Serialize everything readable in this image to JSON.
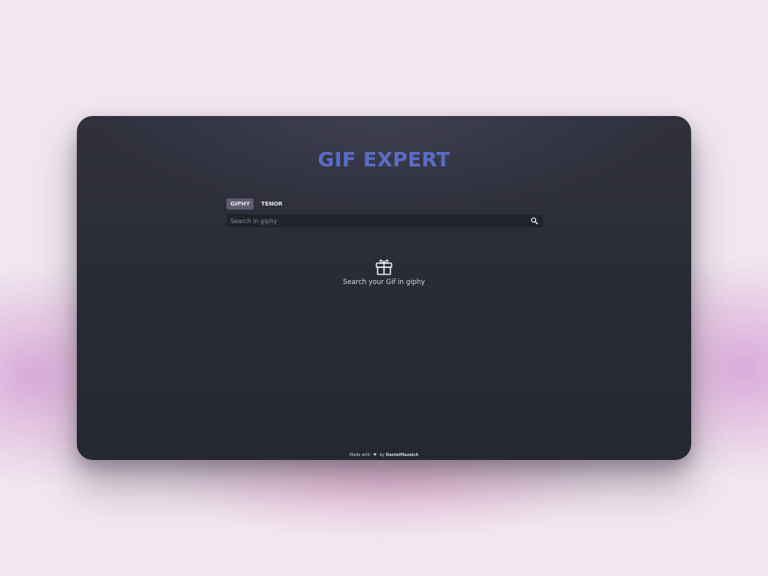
{
  "app": {
    "title": "GIF EXPERT"
  },
  "tabs": [
    {
      "label": "GIPHY",
      "active": true
    },
    {
      "label": "TENOR",
      "active": false
    }
  ],
  "search": {
    "placeholder": "Search in giphy",
    "value": "",
    "icon": "search-icon"
  },
  "empty_state": {
    "icon": "gift-icon",
    "message": "Search your Gif in giphy"
  },
  "footer": {
    "prefix": "Made with",
    "heart": "♥",
    "by": "by",
    "author": "DanielMazeich"
  },
  "colors": {
    "page_background": "#f1e7ef",
    "window_background": "#2a2c35",
    "title_accent": "#5b6cc7",
    "active_tab": "#5d5c72",
    "search_background": "#21232a"
  }
}
